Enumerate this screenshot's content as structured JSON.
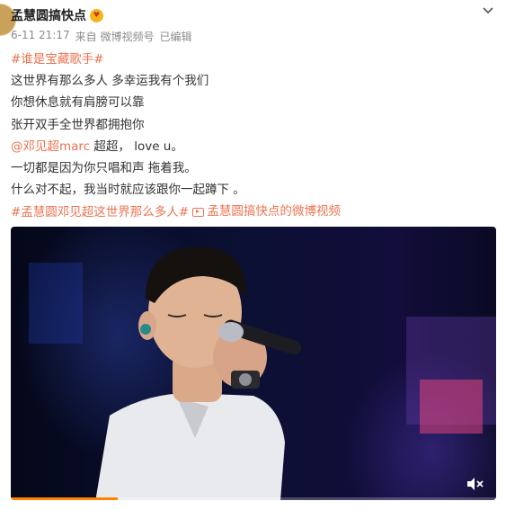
{
  "post": {
    "author_name": "孟慧圆搞快点",
    "badge_icon": "gold-heart-eyes-badge-icon",
    "timestamp": "6-11 21:17",
    "source": "来自 微博视频号",
    "edited": "已编辑",
    "menu_icon": "chevron-down-icon"
  },
  "content": {
    "hashtag1": "#谁是宝藏歌手#",
    "line1": "这世界有那么多人 多幸运我有个我们",
    "line2": "你想休息就有肩膀可以靠",
    "line3": "张开双手全世界都拥抱你",
    "mention": "@邓见超marc",
    "mention_tail": " 超超， love u。",
    "line5": "一切都是因为你只唱和声 拖着我。",
    "line6": "什么对不起，我当时就应该跟你一起蹲下 。",
    "hashtag2": "#孟慧圆邓见超这世界那么多人#",
    "video_link": "孟慧圆搞快点的微博视频"
  },
  "video": {
    "progress": 0.22,
    "progress_color": "#ff8200",
    "mute_icon": "speaker-muted-icon"
  },
  "colors": {
    "link": "#eb7350",
    "meta": "#8b8b8b",
    "text": "#333333"
  }
}
